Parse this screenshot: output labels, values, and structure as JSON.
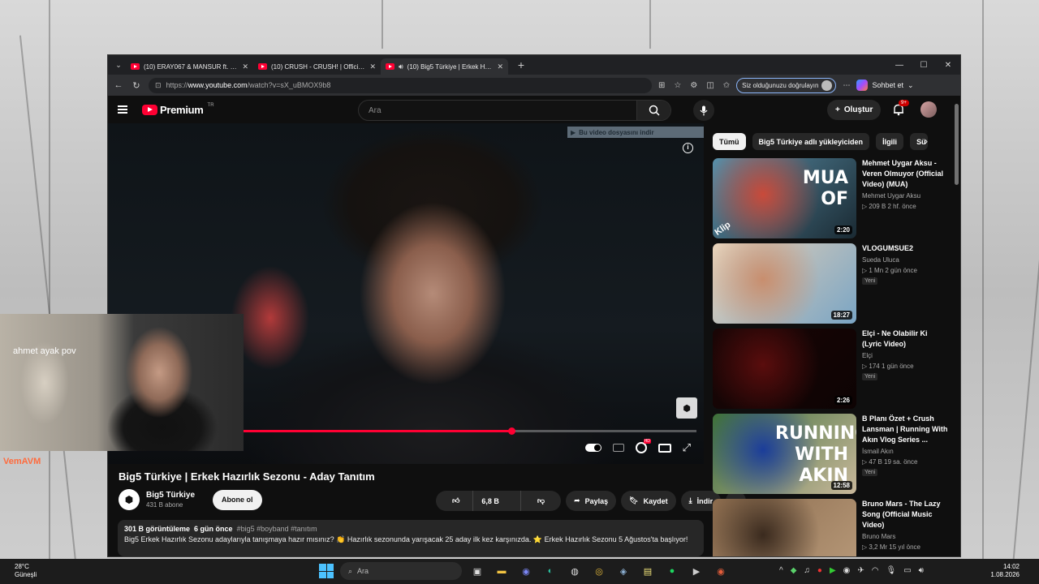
{
  "browser": {
    "tabs": [
      {
        "title": "(10) ERAY067 & MANSUR ft. Contra",
        "active": false
      },
      {
        "title": "(10) CRUSH - CRUSH! | Official Mu",
        "active": false
      },
      {
        "title": "(10) Big5 Türkiye | Erkek Hazır",
        "active": true
      }
    ],
    "url_prefix": "https://",
    "url_domain": "www.youtube.com",
    "url_path": "/watch?v=sX_uBMOX9b8",
    "verify_label": "Siz olduğunuzu doğrulayın",
    "copilot_label": "Sohbet et"
  },
  "youtube": {
    "logo_word": "Premium",
    "logo_region": "TR",
    "search_placeholder": "Ara",
    "create_label": "Oluştur",
    "notifications": "9+"
  },
  "player": {
    "download_banner": "Bu video dosyasını indir",
    "progress": 0.685
  },
  "webcam": {
    "overlay_text": "ahmet ayak pov",
    "brand": "VemAVM"
  },
  "video": {
    "title": "Big5 Türkiye | Erkek Hazırlık Sezonu - Aday Tanıtım",
    "channel": "Big5 Türkiye",
    "subscribers": "431 B abone",
    "subscribe_label": "Abone ol",
    "likes": "6,8 B",
    "share_label": "Paylaş",
    "save_label": "Kaydet",
    "download_label": "İndir",
    "views": "301 B görüntüleme",
    "age": "6 gün önce",
    "tags": "#big5 #boyband #tanıtım",
    "description": "Big5 Erkek Hazırlık Sezonu adaylarıyla tanışmaya hazır mısınız? 👏 Hazırlık sezonunda yarışacak 25 aday ilk kez karşınızda. ⭐ Erkek Hazırlık Sezonu 5 Ağustos'ta başlıyor!"
  },
  "chips": [
    "Tümü",
    "Big5 Türkiye adlı yükleyiciden",
    "İlgili",
    "Sü"
  ],
  "recommendations": [
    {
      "title": "Mehmet Uygar Aksu - Veren Olmuyor (Official Video) (MUA)",
      "channel": "Mehmet Uygar Aksu",
      "stats": "▷ 209 B  2 hf. önce",
      "duration": "2:20",
      "badge": "",
      "thumb_text": "MUA OF",
      "corner": "Klip",
      "colors": [
        "#5a8fa8",
        "#c94a3a",
        "#1a2a33"
      ]
    },
    {
      "title": "VLOGUMSUE2",
      "channel": "Sueda Uluca",
      "stats": "▷ 1 Mn  2 gün önce",
      "duration": "18:27",
      "badge": "Yeni",
      "thumb_text": "",
      "corner": "",
      "colors": [
        "#e9d2b8",
        "#c88e6e",
        "#7aa5c4"
      ]
    },
    {
      "title": "Elçi - Ne Olabilir Ki (Lyric Video)",
      "channel": "Elçi",
      "stats": "▷ 174  1 gün önce",
      "duration": "2:26",
      "badge": "Yeni",
      "thumb_text": "",
      "corner": "",
      "colors": [
        "#1a0606",
        "#5a0d0d",
        "#0d0303"
      ]
    },
    {
      "title": "B Planı Özet + Crush Lansman | Running With Akın Vlog Series ...",
      "channel": "İsmail Akın",
      "stats": "▷ 47 B  19 sa. önce",
      "duration": "12:58",
      "badge": "Yeni",
      "thumb_text": "RUNNING WITH AKIN",
      "corner": "",
      "colors": [
        "#3c6f3a",
        "#1b3d9a",
        "#c8b79a"
      ]
    },
    {
      "title": "Bruno Mars - The Lazy Song (Official Music Video)",
      "channel": "Bruno Mars",
      "stats": "▷ 3,2 Mr  15 yıl önce",
      "duration": "",
      "badge": "",
      "thumb_text": "",
      "corner": "",
      "colors": [
        "#8a6a4c",
        "#3a2a1e",
        "#b89a7a"
      ]
    }
  ],
  "taskbar": {
    "temp": "28°C",
    "weather": "Güneşli",
    "search": "Ara",
    "time": "14:02",
    "date": "1.08.2026"
  }
}
